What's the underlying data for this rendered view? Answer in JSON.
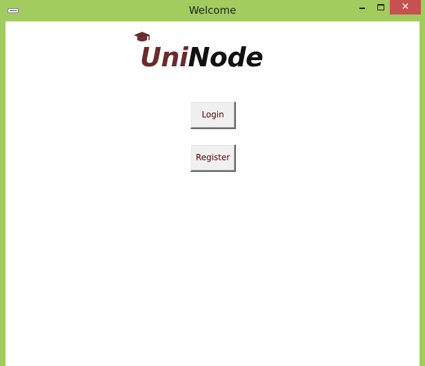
{
  "window": {
    "title": "Welcome",
    "close_glyph": "✕"
  },
  "logo": {
    "part1": "Uni",
    "part2": "Node",
    "icon": "graduation-cap-icon",
    "colors": {
      "uni": "#6b2b2b",
      "node": "#111111"
    }
  },
  "buttons": {
    "login": "Login",
    "register": "Register"
  },
  "colors": {
    "frame": "#a2cc5e",
    "close_button": "#c75050",
    "button_text": "#5a0000"
  }
}
